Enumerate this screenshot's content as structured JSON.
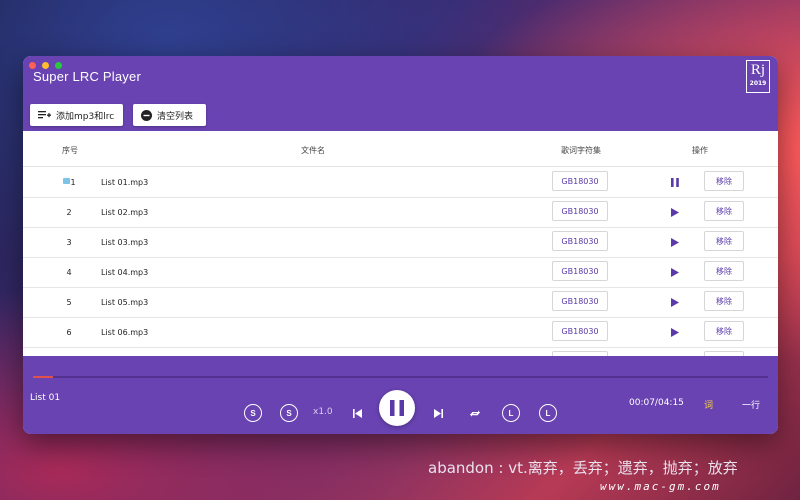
{
  "window": {
    "title": "Super LRC Player",
    "logo": {
      "text": "Rj",
      "year": "2019"
    }
  },
  "toolbar": {
    "add_label": "添加mp3和lrc",
    "clear_label": "清空列表"
  },
  "table": {
    "headers": {
      "index": "序号",
      "filename": "文件名",
      "charset": "歌词字符集",
      "actions": "操作"
    },
    "rows": [
      {
        "index": "1",
        "filename": "List 01.mp3",
        "charset": "GB18030",
        "action": "pause",
        "remove": "移除",
        "playing": true
      },
      {
        "index": "2",
        "filename": "List 02.mp3",
        "charset": "GB18030",
        "action": "play",
        "remove": "移除"
      },
      {
        "index": "3",
        "filename": "List 03.mp3",
        "charset": "GB18030",
        "action": "play",
        "remove": "移除"
      },
      {
        "index": "4",
        "filename": "List 04.mp3",
        "charset": "GB18030",
        "action": "play",
        "remove": "移除"
      },
      {
        "index": "5",
        "filename": "List 05.mp3",
        "charset": "GB18030",
        "action": "play",
        "remove": "移除"
      },
      {
        "index": "6",
        "filename": "List 06.mp3",
        "charset": "GB18030",
        "action": "play",
        "remove": "移除"
      }
    ]
  },
  "player": {
    "track_name": "List 01",
    "progress": 0.027,
    "speed": "x1.0",
    "time": "00:07/04:15",
    "lyric_label": "词",
    "line_label": "一行",
    "rewind_label": "S",
    "forward_label": "S",
    "loop_a_label": "L",
    "loop_b_label": "L"
  },
  "caption": "abandon : vt.离弃，丢弃；遗弃，抛弃；放弃",
  "watermark": "www.mac-gm.com",
  "colors": {
    "accent": "#6943b2",
    "progress": "#e0514c",
    "lyric": "#f6d24a"
  }
}
